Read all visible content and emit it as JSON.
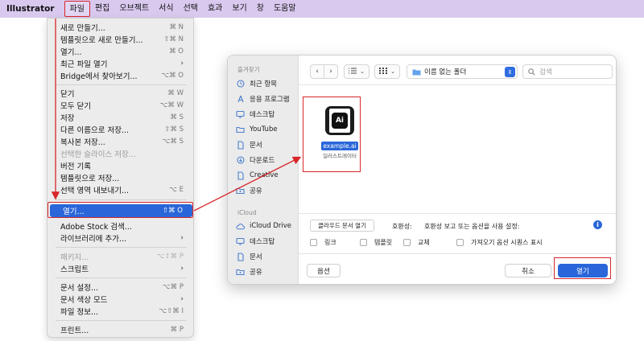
{
  "menubar": {
    "app_name": "Illustrator",
    "items": [
      "파일",
      "편집",
      "오브젝트",
      "서식",
      "선택",
      "효과",
      "보기",
      "창",
      "도움말"
    ],
    "active_index": 0
  },
  "file_menu": {
    "items": [
      {
        "label": "새로 만들기...",
        "shortcut": "⌘ N"
      },
      {
        "label": "템플릿으로 새로 만들기...",
        "shortcut": "⇧⌘ N"
      },
      {
        "label": "열기...",
        "shortcut": "⌘ O"
      },
      {
        "label": "최근 파일 열기",
        "shortcut": "",
        "submenu": true
      },
      {
        "label": "Bridge에서 찾아보기...",
        "shortcut": "⌥⌘ O"
      },
      {
        "label": "닫기",
        "shortcut": "⌘ W"
      },
      {
        "label": "모두 닫기",
        "shortcut": "⌥⌘ W"
      },
      {
        "label": "저장",
        "shortcut": "⌘ S"
      },
      {
        "label": "다른 이름으로 저장...",
        "shortcut": "⇧⌘ S"
      },
      {
        "label": "복사본 저장...",
        "shortcut": "⌥⌘ S"
      },
      {
        "label": "선택한 슬라이스 저장...",
        "shortcut": "",
        "disabled": true
      },
      {
        "label": "버전 기록",
        "shortcut": ""
      },
      {
        "label": "템플릿으로 저장...",
        "shortcut": ""
      },
      {
        "label": "선택 영역 내보내기...",
        "shortcut": "⌥ E"
      },
      {
        "label": "열기...",
        "shortcut": "⇧⌘ O",
        "highlighted": true
      },
      {
        "label": "Adobe Stock 검색...",
        "shortcut": ""
      },
      {
        "label": "라이브러리에 추가...",
        "shortcut": "",
        "submenu": true
      },
      {
        "label": "패키지...",
        "shortcut": "⌥⇧⌘ P",
        "disabled": true
      },
      {
        "label": "스크립트",
        "shortcut": "",
        "submenu": true
      },
      {
        "label": "문서 설정...",
        "shortcut": "⌥⌘ P"
      },
      {
        "label": "문서 색상 모드",
        "shortcut": "",
        "submenu": true
      },
      {
        "label": "파일 정보...",
        "shortcut": "⌥⇧⌘ I"
      },
      {
        "label": "프린트...",
        "shortcut": "⌘ P"
      }
    ]
  },
  "dialog": {
    "sidebar": {
      "favorites_header": "즐겨찾기",
      "favorites": [
        {
          "label": "최근 항목",
          "icon": "clock-icon"
        },
        {
          "label": "응용 프로그램",
          "icon": "applications-icon"
        },
        {
          "label": "데스크탑",
          "icon": "desktop-icon"
        },
        {
          "label": "YouTube",
          "icon": "folder-icon"
        },
        {
          "label": "문서",
          "icon": "document-icon"
        },
        {
          "label": "다운로드",
          "icon": "download-icon"
        },
        {
          "label": "Creative",
          "icon": "document-icon"
        },
        {
          "label": "공유",
          "icon": "shared-folder-icon"
        }
      ],
      "icloud_header": "iCloud",
      "icloud": [
        {
          "label": "iCloud Drive",
          "icon": "cloud-icon"
        },
        {
          "label": "데스크탑",
          "icon": "desktop-icon"
        },
        {
          "label": "문서",
          "icon": "document-icon"
        },
        {
          "label": "공유",
          "icon": "shared-folder-icon"
        }
      ]
    },
    "toolbar": {
      "folder_name": "이름 없는 폴더",
      "search_placeholder": "검색"
    },
    "file": {
      "name": "example.ai",
      "kind": "일러스트레이터",
      "icon_text": "Ai"
    },
    "options": {
      "cloud_button": "클라우드 문서 열기",
      "compat_label": "호환성:",
      "compat_text": "호환성 보고 또는 옵션을 사용 설정:",
      "checkboxes": [
        "링크",
        "템플릿",
        "교체",
        "가져오기 옵션 시퀀스 표시"
      ]
    },
    "footer": {
      "options_button": "옵션",
      "cancel_button": "취소",
      "open_button": "열기"
    }
  },
  "colors": {
    "menubar_bg": "#d9c9ef",
    "highlight": "#2a66d9",
    "annotation_red": "#d8262b"
  }
}
